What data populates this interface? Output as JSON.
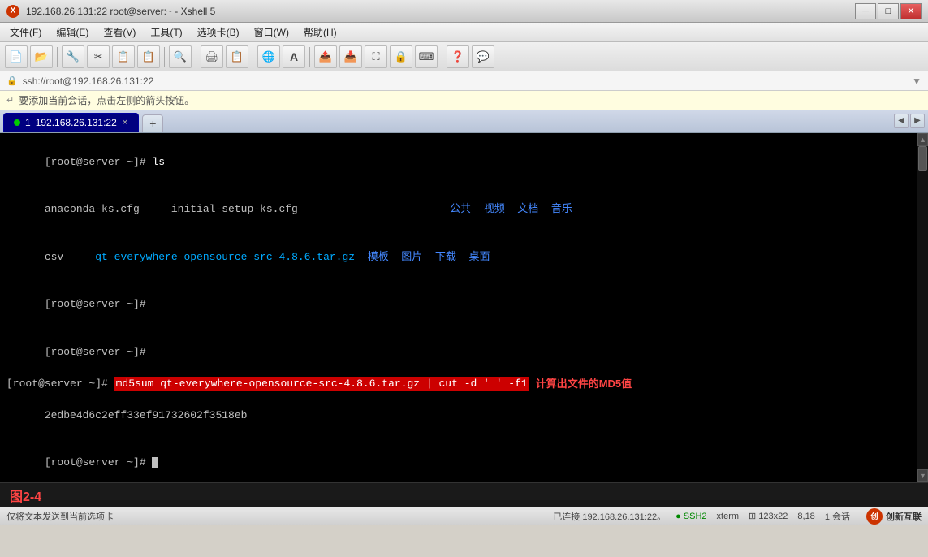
{
  "titlebar": {
    "ip": "192.168.26.131:22",
    "user": "root@server:~",
    "app": "Xshell 5",
    "full_title": "192.168.26.131:22    root@server:~ - Xshell 5",
    "min_btn": "─",
    "max_btn": "□",
    "close_btn": "✕"
  },
  "menubar": {
    "items": [
      {
        "label": "文件(F)"
      },
      {
        "label": "编辑(E)"
      },
      {
        "label": "查看(V)"
      },
      {
        "label": "工具(T)"
      },
      {
        "label": "选项卡(B)"
      },
      {
        "label": "窗口(W)"
      },
      {
        "label": "帮助(H)"
      }
    ]
  },
  "toolbar": {
    "buttons": [
      "📄",
      "📁",
      "🔧",
      "✂",
      "📋",
      "📋",
      "🔍",
      "🖨",
      "📋",
      "🌐",
      "A",
      "✉",
      "⚙",
      "⚙",
      "❓",
      "💬"
    ]
  },
  "addressbar": {
    "icon": "🔒",
    "address": "ssh://root@192.168.26.131:22",
    "arrow": "▼"
  },
  "infobar": {
    "icon": "↵",
    "text": "要添加当前会话，点击左侧的箭头按钮。"
  },
  "tabbar": {
    "tab_number": "1",
    "tab_ip": "192.168.26.131:22",
    "tab_close": "✕",
    "add_btn": "+",
    "nav_left": "◀",
    "nav_right": "▶"
  },
  "terminal": {
    "lines": [
      {
        "type": "prompt_cmd",
        "prompt": "[root@server ~]# ",
        "cmd": "ls"
      },
      {
        "type": "ls_output_row1",
        "col1": "anaconda-ks.cfg",
        "col2": "initial-setup-ks.cfg",
        "col3": "公共",
        "col4": "视频",
        "col5": "文档",
        "col6": "音乐"
      },
      {
        "type": "ls_output_row2",
        "col1_link": "qt-everywhere-opensource-src-4.8.6.tar.gz",
        "col2": "模板",
        "col3": "图片",
        "col4": "下载",
        "col5": "桌面"
      },
      {
        "type": "ls_output_row3",
        "col1": "csv"
      },
      {
        "type": "blank_prompt",
        "prompt": "[root@server ~]#"
      },
      {
        "type": "blank_prompt2",
        "prompt": "[root@server ~]#"
      },
      {
        "type": "md5_cmd",
        "prompt": "[root@server ~]# ",
        "cmd_highlight": "md5sum qt-everywhere-opensource-src-4.8.6.tar.gz | cut -d ' ' -f1",
        "annotation": "计算出文件的MD5值"
      },
      {
        "type": "md5_result",
        "result": "2edbe4d6c2eff33ef91732602f3518eb"
      },
      {
        "type": "final_prompt",
        "prompt": "[root@server ~]# "
      }
    ]
  },
  "figure": {
    "label": "图2-4"
  },
  "statusbar": {
    "left": "仅将文本发送到当前选项卡",
    "connection": "已连接 192.168.26.131:22。",
    "protocol": "● SSH2",
    "terminal": "xterm",
    "size": "⊞ 123x22",
    "position": "8,18",
    "sessions": "1 会话",
    "logo_text": "创新互联"
  }
}
